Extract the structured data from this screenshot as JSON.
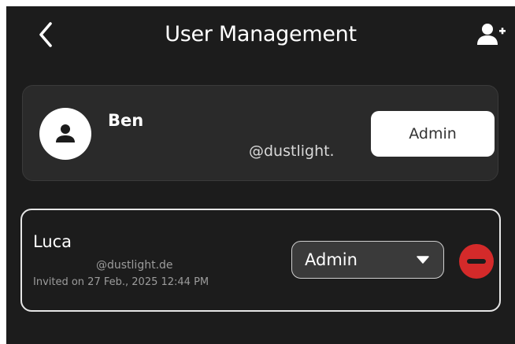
{
  "header": {
    "title": "User Management",
    "back_icon": "chevron-left-icon",
    "add_user_icon": "add-user-icon"
  },
  "current_user": {
    "name": "Ben",
    "handle": "@dustlight.",
    "role": "Admin",
    "avatar_icon": "person-icon"
  },
  "members": [
    {
      "name": "Luca",
      "handle": "@dustlight.de",
      "invited": "Invited on 27 Feb., 2025 12:44 PM",
      "role": "Admin",
      "remove_icon": "minus-circle-icon"
    }
  ],
  "colors": {
    "background": "#1c1c1c",
    "card": "#2a2a2a",
    "remove": "#d42a2a",
    "text": "#ffffff"
  }
}
